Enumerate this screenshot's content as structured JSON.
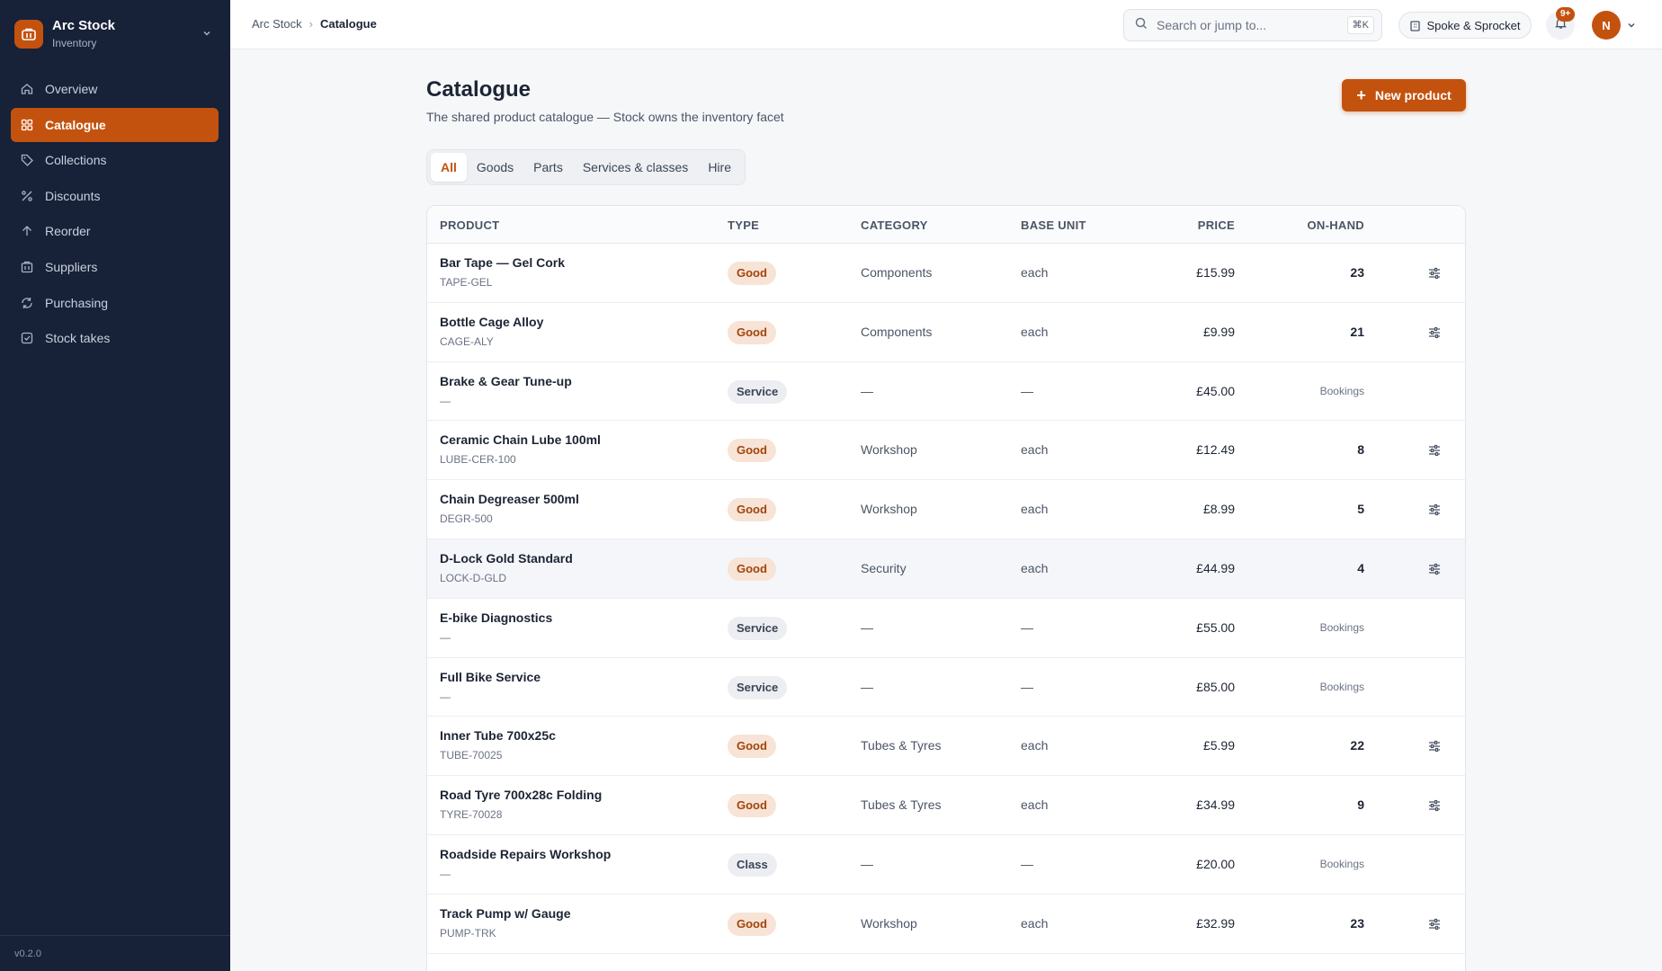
{
  "app": {
    "name": "Arc Stock",
    "section": "Inventory",
    "version": "v0.2.0",
    "accent": "#c4520f",
    "sidebar_bg": "#172138"
  },
  "sidebar": {
    "items": [
      {
        "label": "Overview",
        "icon": "home-icon",
        "active": false
      },
      {
        "label": "Catalogue",
        "icon": "grid-icon",
        "active": true
      },
      {
        "label": "Collections",
        "icon": "tag-icon",
        "active": false
      },
      {
        "label": "Discounts",
        "icon": "percent-icon",
        "active": false
      },
      {
        "label": "Reorder",
        "icon": "arrow-up-icon",
        "active": false
      },
      {
        "label": "Suppliers",
        "icon": "building-icon",
        "active": false
      },
      {
        "label": "Purchasing",
        "icon": "refresh-icon",
        "active": false
      },
      {
        "label": "Stock takes",
        "icon": "check-square-icon",
        "active": false
      }
    ]
  },
  "topbar": {
    "breadcrumb_root": "Arc Stock",
    "breadcrumb_current": "Catalogue",
    "search_placeholder": "Search or jump to...",
    "search_shortcut": "⌘K",
    "org_name": "Spoke & Sprocket",
    "notification_count": "9+",
    "avatar_initial": "N"
  },
  "page": {
    "title": "Catalogue",
    "subtitle": "The shared product catalogue — Stock owns the inventory facet",
    "new_button": "New product",
    "tabs": [
      {
        "label": "All",
        "active": true
      },
      {
        "label": "Goods",
        "active": false
      },
      {
        "label": "Parts",
        "active": false
      },
      {
        "label": "Services & classes",
        "active": false
      },
      {
        "label": "Hire",
        "active": false
      }
    ]
  },
  "table": {
    "headers": {
      "product": "PRODUCT",
      "type": "TYPE",
      "category": "CATEGORY",
      "base_unit": "BASE UNIT",
      "price": "PRICE",
      "on_hand": "ON-HAND"
    },
    "rows": [
      {
        "name": "Bar Tape — Gel Cork",
        "sku": "TAPE-GEL",
        "type": "Good",
        "category": "Components",
        "unit": "each",
        "price": "£15.99",
        "on_hand": "23",
        "adjustable": true
      },
      {
        "name": "Bottle Cage Alloy",
        "sku": "CAGE-ALY",
        "type": "Good",
        "category": "Components",
        "unit": "each",
        "price": "£9.99",
        "on_hand": "21",
        "adjustable": true
      },
      {
        "name": "Brake & Gear Tune-up",
        "sku": "—",
        "type": "Service",
        "category": "—",
        "unit": "—",
        "price": "£45.00",
        "on_hand": "Bookings",
        "adjustable": false
      },
      {
        "name": "Ceramic Chain Lube 100ml",
        "sku": "LUBE-CER-100",
        "type": "Good",
        "category": "Workshop",
        "unit": "each",
        "price": "£12.49",
        "on_hand": "8",
        "adjustable": true
      },
      {
        "name": "Chain Degreaser 500ml",
        "sku": "DEGR-500",
        "type": "Good",
        "category": "Workshop",
        "unit": "each",
        "price": "£8.99",
        "on_hand": "5",
        "adjustable": true
      },
      {
        "name": "D-Lock Gold Standard",
        "sku": "LOCK-D-GLD",
        "type": "Good",
        "category": "Security",
        "unit": "each",
        "price": "£44.99",
        "on_hand": "4",
        "adjustable": true,
        "highlighted": true
      },
      {
        "name": "E-bike Diagnostics",
        "sku": "—",
        "type": "Service",
        "category": "—",
        "unit": "—",
        "price": "£55.00",
        "on_hand": "Bookings",
        "adjustable": false
      },
      {
        "name": "Full Bike Service",
        "sku": "—",
        "type": "Service",
        "category": "—",
        "unit": "—",
        "price": "£85.00",
        "on_hand": "Bookings",
        "adjustable": false
      },
      {
        "name": "Inner Tube 700x25c",
        "sku": "TUBE-70025",
        "type": "Good",
        "category": "Tubes & Tyres",
        "unit": "each",
        "price": "£5.99",
        "on_hand": "22",
        "adjustable": true
      },
      {
        "name": "Road Tyre 700x28c Folding",
        "sku": "TYRE-70028",
        "type": "Good",
        "category": "Tubes & Tyres",
        "unit": "each",
        "price": "£34.99",
        "on_hand": "9",
        "adjustable": true
      },
      {
        "name": "Roadside Repairs Workshop",
        "sku": "—",
        "type": "Class",
        "category": "—",
        "unit": "—",
        "price": "£20.00",
        "on_hand": "Bookings",
        "adjustable": false
      },
      {
        "name": "Track Pump w/ Gauge",
        "sku": "PUMP-TRK",
        "type": "Good",
        "category": "Workshop",
        "unit": "each",
        "price": "£32.99",
        "on_hand": "23",
        "adjustable": true
      }
    ]
  }
}
